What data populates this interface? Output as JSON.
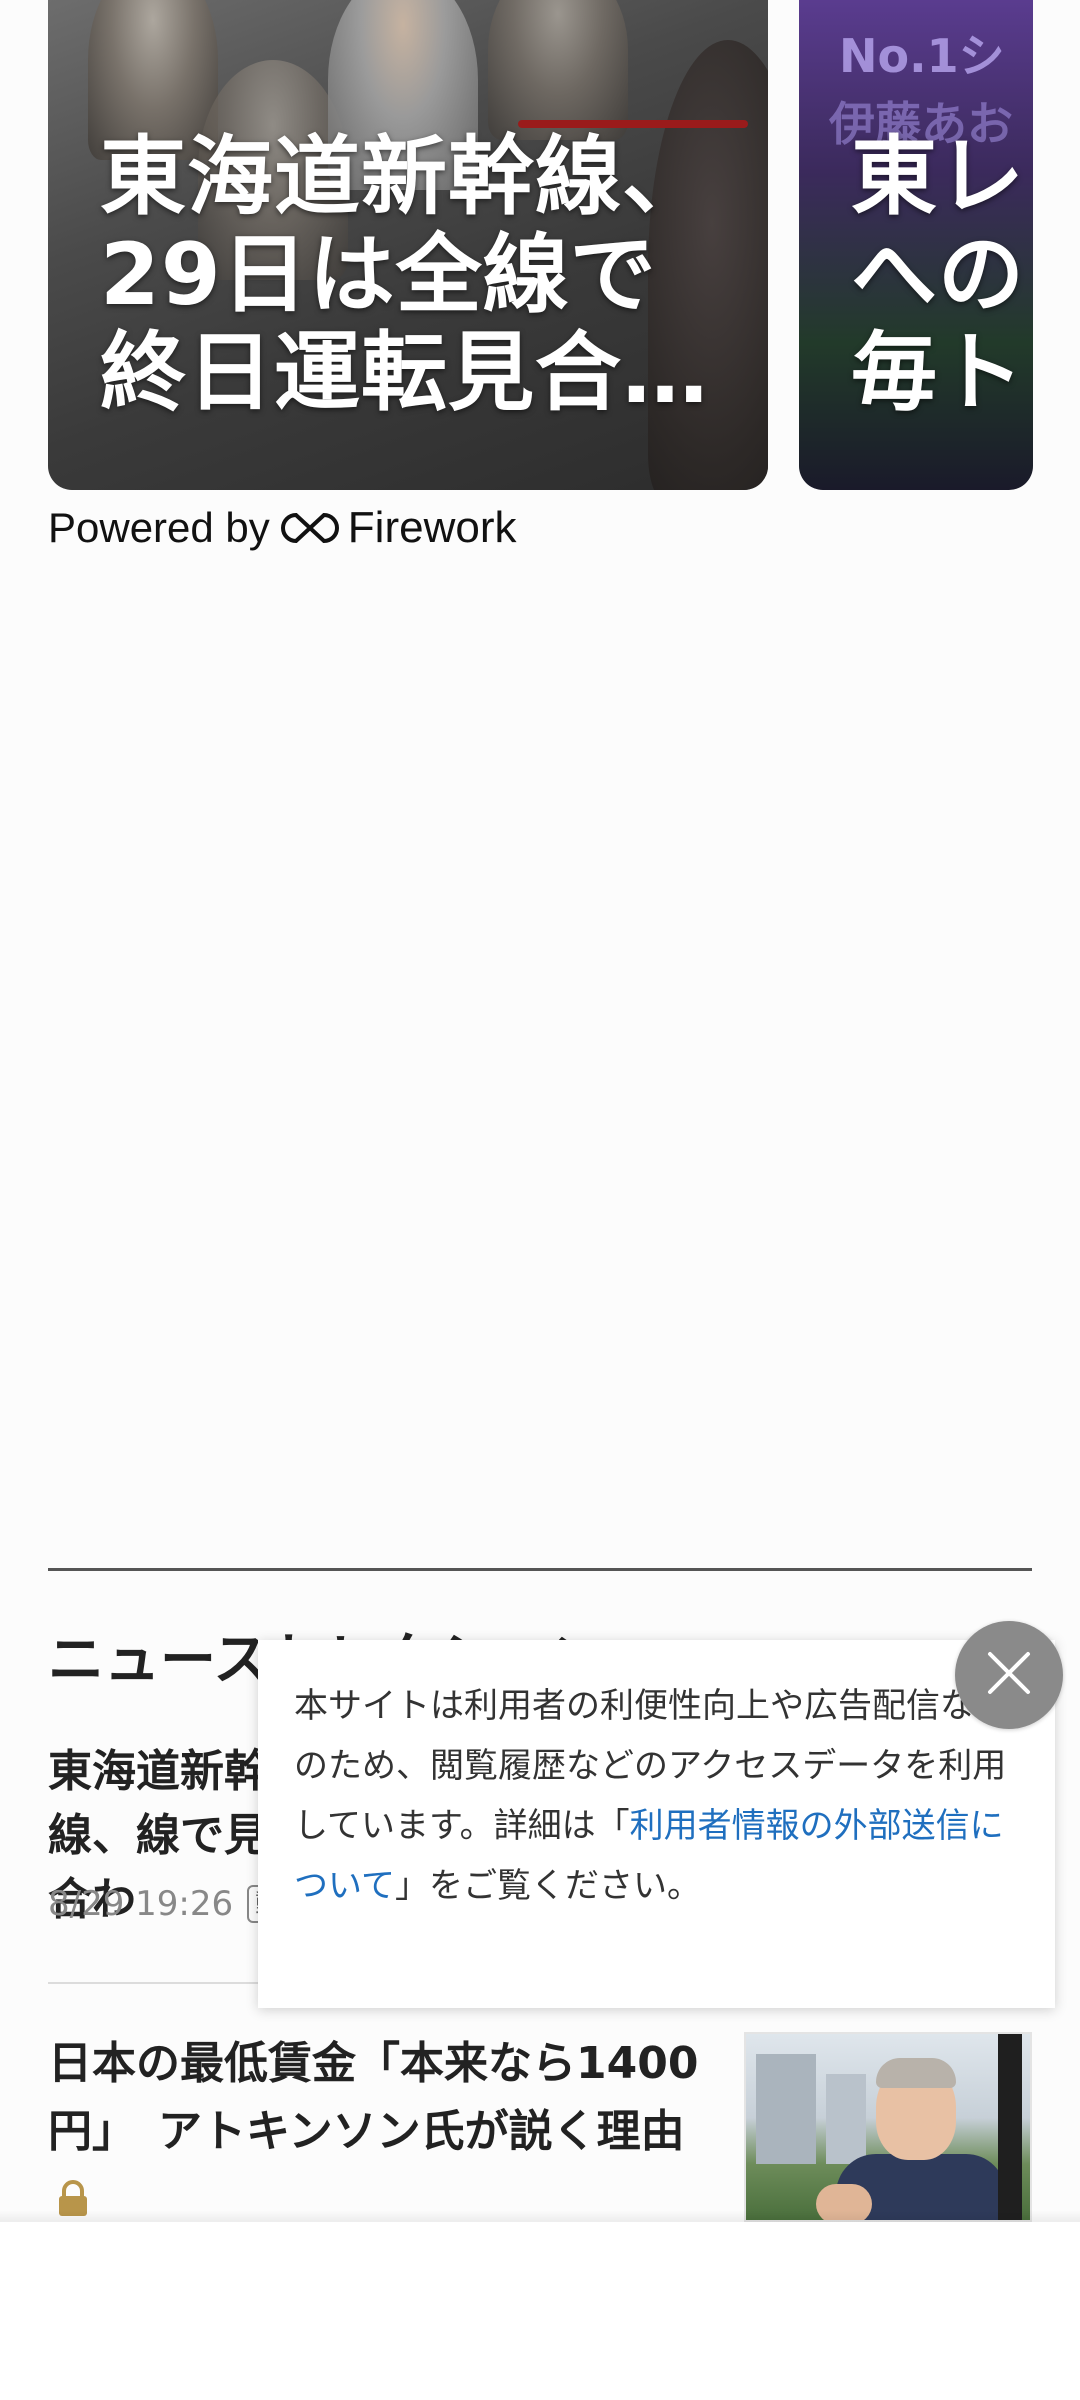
{
  "carousel": {
    "cards": [
      {
        "title": "東海道新幹線、\n29日は全線で\n終日運転見合…"
      },
      {
        "title": "東レ\nへの\n毎ト",
        "badge_line1": "No.1シ",
        "badge_line2": "伊藤あお"
      }
    ],
    "powered_by": "Powered by",
    "brand": "Firework"
  },
  "section": {
    "title": "ニュースセレクション"
  },
  "articles": [
    {
      "title": "東海道新幹線、線で見合わ",
      "time": "8/29 19:26",
      "tag": "動"
    },
    {
      "title": "日本の最低賃金「本来なら1400円」　アトキンソン氏が説く理由"
    }
  ],
  "consent": {
    "text_before": "本サイトは利用者の利便性向上や広告配信などのため、閲覧履歴などのアクセスデータを利用しています。詳細は「",
    "link_text": "利用者情報の外部送信について",
    "text_after": "」をご覧ください。"
  },
  "icons": {
    "close": "close-icon",
    "lock": "lock-icon",
    "brand": "firework-logo-icon"
  },
  "colors": {
    "link": "#1f6fbf",
    "lock": "#b8954a",
    "close_bg": "#8a8a8a"
  }
}
